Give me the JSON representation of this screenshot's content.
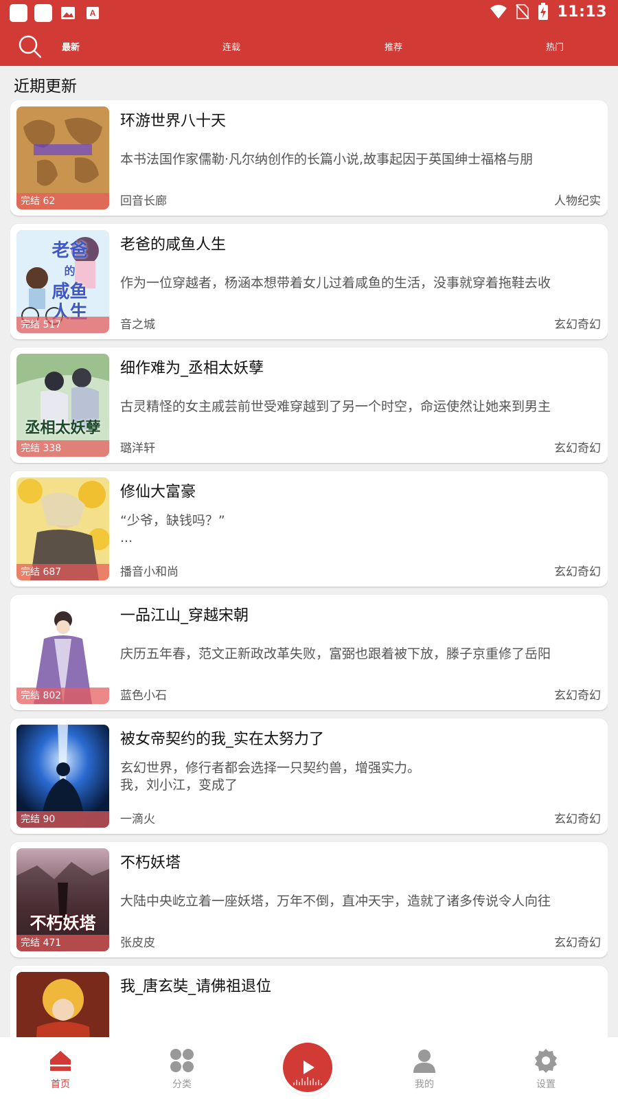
{
  "status_bar": {
    "time": "11:13"
  },
  "colors": {
    "brand": "#d23a36",
    "text": "#111111",
    "muted": "#555555",
    "bg": "#efefef"
  },
  "top_nav": {
    "tabs": [
      {
        "label": "最新",
        "active": true
      },
      {
        "label": "连载",
        "active": false
      },
      {
        "label": "推荐",
        "active": false
      },
      {
        "label": "热门",
        "active": false
      }
    ]
  },
  "section_title": "近期更新",
  "books": [
    {
      "title": "环游世界八十天",
      "desc": "本书法国作家儒勒·凡尔纳创作的长篇小说,故事起因于英国绅士福格与朋",
      "author": "回音长廊",
      "genre": "人物纪实",
      "badge": "完结 62"
    },
    {
      "title": "老爸的咸鱼人生",
      "desc": "作为一位穿越者，杨涵本想带着女儿过着咸鱼的生活，没事就穿着拖鞋去收",
      "author": "音之城",
      "genre": "玄幻奇幻",
      "badge": "完结 517",
      "cover_text": "老爸的咸鱼人生"
    },
    {
      "title": "细作难为_丞相太妖孽",
      "desc": "古灵精怪的女主戚芸前世受难穿越到了另一个时空，命运使然让她来到男主",
      "author": "璐洋轩",
      "genre": "玄幻奇幻",
      "badge": "完结 338",
      "cover_text": "丞相太妖孽"
    },
    {
      "title": "修仙大富豪",
      "desc": "“少爷，缺钱吗？”",
      "desc2": "...",
      "author": "播音小和尚",
      "genre": "玄幻奇幻",
      "badge": "完结 687"
    },
    {
      "title": "一品江山_穿越宋朝",
      "desc": "庆历五年春，范文正新政改革失败，富弼也跟着被下放，滕子京重修了岳阳",
      "author": "蓝色小石",
      "genre": "玄幻奇幻",
      "badge": "完结 802"
    },
    {
      "title": "被女帝契约的我_实在太努力了",
      "desc": "玄幻世界，修行者都会选择一只契约兽，增强实力。",
      "desc2": "我，刘小江，变成了",
      "author": "一滴火",
      "genre": "玄幻奇幻",
      "badge": "完结 90"
    },
    {
      "title": "不朽妖塔",
      "desc": "大陆中央屹立着一座妖塔，万年不倒，直冲天宇，造就了诸多传说令人向往",
      "author": "张皮皮",
      "genre": "玄幻奇幻",
      "badge": "完结 471",
      "cover_text": "不朽妖塔"
    },
    {
      "title": "我_唐玄奘_请佛祖退位",
      "desc": "",
      "author": "",
      "genre": "",
      "badge": ""
    }
  ],
  "bottom_nav": {
    "items": [
      {
        "label": "首页",
        "active": true
      },
      {
        "label": "分类",
        "active": false
      },
      {
        "label": "我的",
        "active": false
      },
      {
        "label": "设置",
        "active": false
      }
    ]
  }
}
